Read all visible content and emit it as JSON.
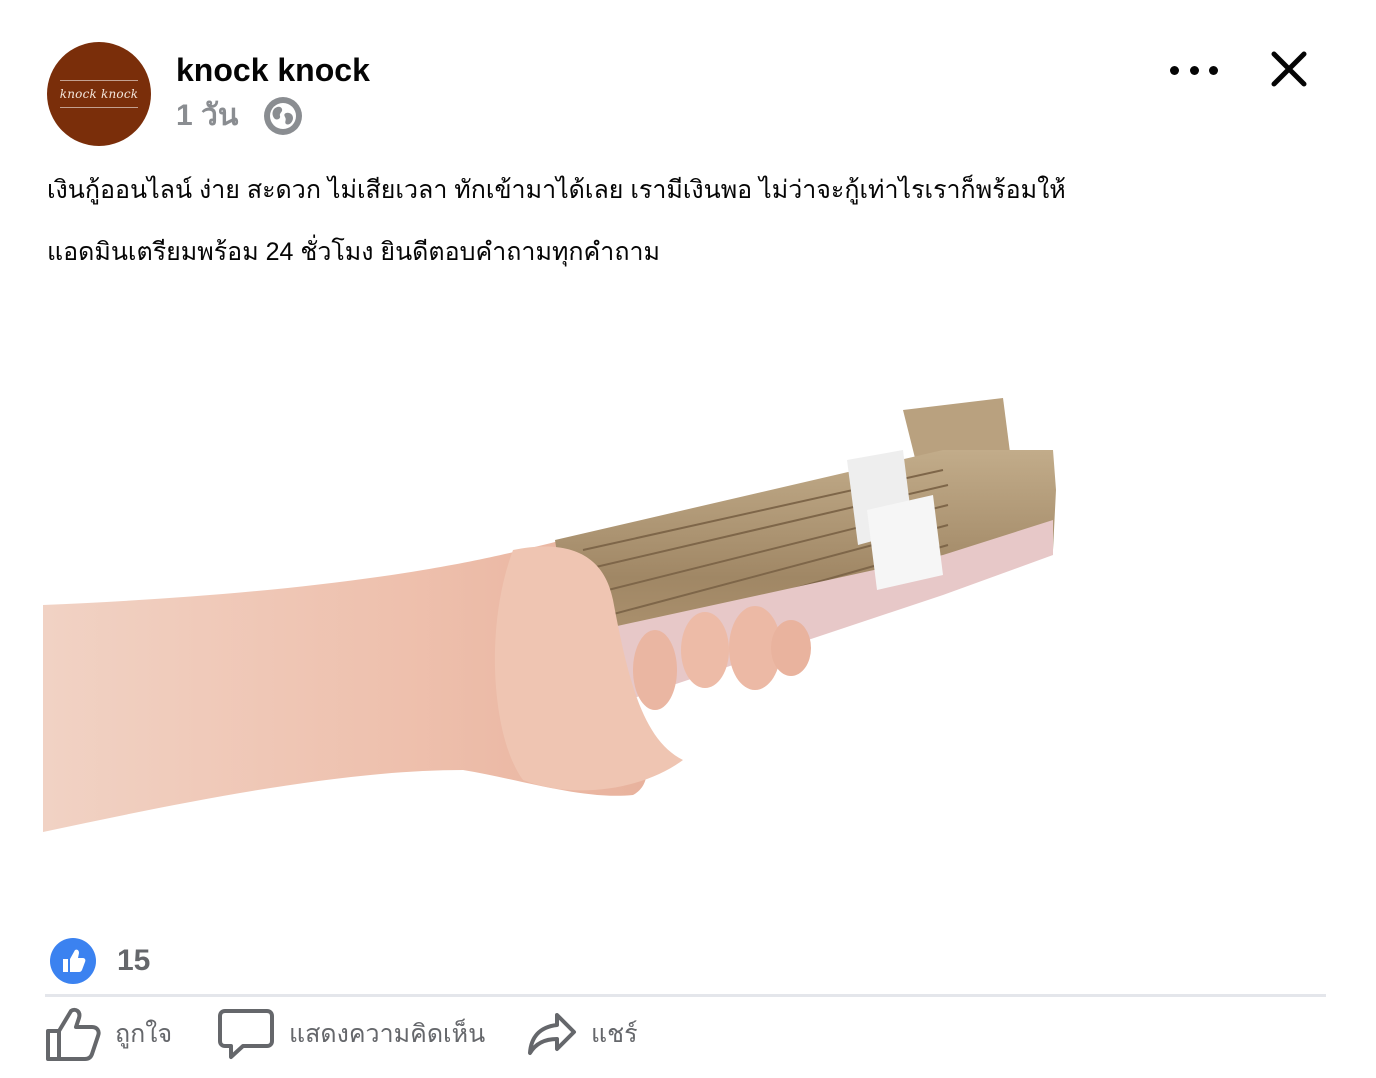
{
  "post": {
    "author": "knock knock",
    "avatar_text": "knock knock",
    "time": "1 วัน",
    "audience_icon": "globe-icon",
    "text_lines": [
      "เงินกู้ออนไลน์ ง่าย สะดวก ไม่เสียเวลา ทักเข้ามาได้เลย เรามีเงินพอ ไม่ว่าจะกู้เท่าไรเราก็พร้อมให้",
      "แอดมินเตรียมพร้อม 24 ชั่วโมง ยินดีตอบคำถามทุกคำถาม"
    ]
  },
  "reactions": {
    "icon": "like-reaction-icon",
    "count": "15"
  },
  "actions": {
    "like": "ถูกใจ",
    "comment": "แสดงความคิดเห็น",
    "share": "แชร์"
  },
  "colors": {
    "avatar_bg": "#7a2e0a",
    "meta_gray": "#8a8d91",
    "action_gray": "#65676b",
    "like_blue": "#3b82f0",
    "divider": "#e4e6eb"
  }
}
